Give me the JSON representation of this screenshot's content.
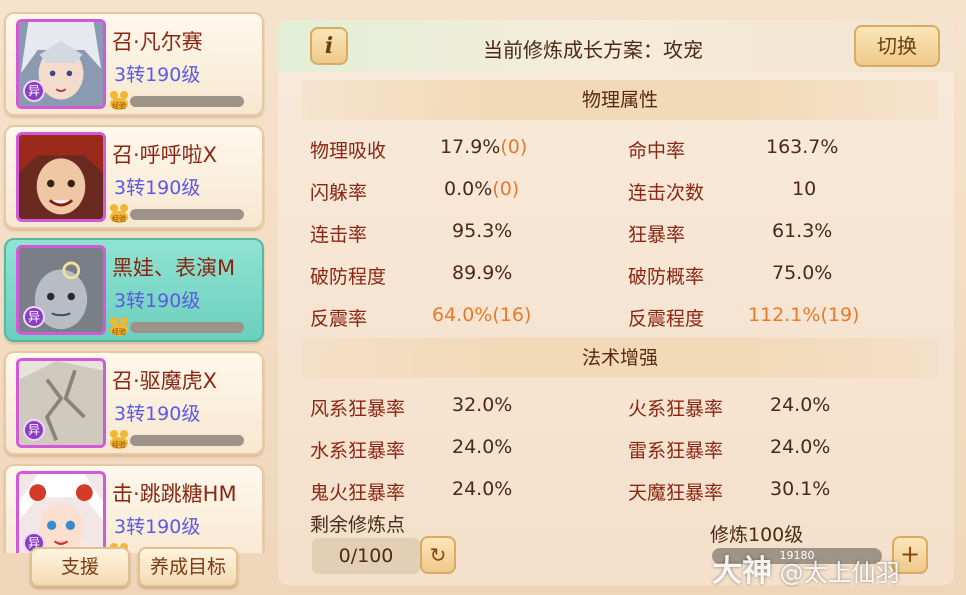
{
  "pets": [
    {
      "name": "召·凡尔赛",
      "level": "3转190级",
      "badge": "异",
      "exp_label": "经验",
      "exp_progress": 0,
      "selected": false,
      "avatar": "silver-hair-portrait"
    },
    {
      "name": "召·呼呼啦X",
      "level": "3转190级",
      "badge": "",
      "exp_label": "经验",
      "exp_progress": 0,
      "selected": false,
      "avatar": "red-hair-portrait"
    },
    {
      "name": "黑娃、表演M",
      "level": "3转190级",
      "badge": "异",
      "exp_label": "经验",
      "exp_progress": 0,
      "selected": true,
      "avatar": "grey-masked-portrait"
    },
    {
      "name": "召·驱魔虎X",
      "level": "3转190级",
      "badge": "异",
      "exp_label": "经验",
      "exp_progress": 0,
      "selected": false,
      "avatar": "white-tiger-portrait"
    },
    {
      "name": "击·跳跳糖HM",
      "level": "3转190级",
      "badge": "异",
      "exp_label": "经验",
      "exp_progress": 0,
      "selected": false,
      "avatar": "white-red-girl-portrait"
    }
  ],
  "left_buttons": {
    "support": "支援",
    "goal": "养成目标"
  },
  "header": {
    "info_icon": "i",
    "title": "当前修炼成长方案：攻宠",
    "switch_label": "切换"
  },
  "sections": {
    "physical": "物理属性",
    "magic": "法术增强"
  },
  "physical_stats": [
    {
      "label": "物理吸收",
      "value": "17.9%",
      "bonus": "(0)",
      "highlight": false
    },
    {
      "label": "命中率",
      "value": "163.7%",
      "bonus": "",
      "highlight": false
    },
    {
      "label": "闪躲率",
      "value": "0.0%",
      "bonus": "(0)",
      "highlight": false
    },
    {
      "label": "连击次数",
      "value": "10",
      "bonus": "",
      "highlight": false
    },
    {
      "label": "连击率",
      "value": "95.3%",
      "bonus": "",
      "highlight": false
    },
    {
      "label": "狂暴率",
      "value": "61.3%",
      "bonus": "",
      "highlight": false
    },
    {
      "label": "破防程度",
      "value": "89.9%",
      "bonus": "",
      "highlight": false
    },
    {
      "label": "破防概率",
      "value": "75.0%",
      "bonus": "",
      "highlight": false
    },
    {
      "label": "反震率",
      "value": "64.0%",
      "bonus": "(16)",
      "highlight": true
    },
    {
      "label": "反震程度",
      "value": "112.1%",
      "bonus": "(19)",
      "highlight": true
    }
  ],
  "magic_stats": [
    {
      "label": "风系狂暴率",
      "value": "32.0%"
    },
    {
      "label": "火系狂暴率",
      "value": "24.0%"
    },
    {
      "label": "水系狂暴率",
      "value": "24.0%"
    },
    {
      "label": "雷系狂暴率",
      "value": "24.0%"
    },
    {
      "label": "鬼火狂暴率",
      "value": "24.0%"
    },
    {
      "label": "天魔狂暴率",
      "value": "30.1%"
    }
  ],
  "footer": {
    "remaining_label": "剩余修炼点",
    "points": "0/100",
    "refresh_icon": "↻",
    "level_label": "修炼100级",
    "level_bar_text": "19180",
    "plus_icon": "+"
  },
  "watermark": {
    "brand": "大神",
    "user": "@太上仙羽"
  },
  "colors": {
    "selected_card": "#6ccfbd",
    "label": "#8a2612",
    "level": "#5a5ae6",
    "highlight": "#e87a2a"
  }
}
